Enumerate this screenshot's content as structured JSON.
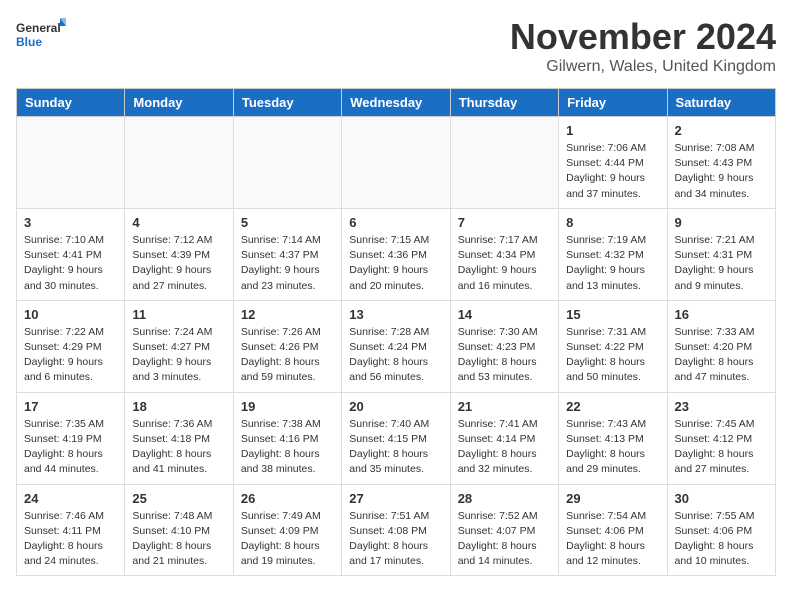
{
  "logo": {
    "general": "General",
    "blue": "Blue"
  },
  "title": "November 2024",
  "location": "Gilwern, Wales, United Kingdom",
  "headers": [
    "Sunday",
    "Monday",
    "Tuesday",
    "Wednesday",
    "Thursday",
    "Friday",
    "Saturday"
  ],
  "weeks": [
    [
      {
        "day": "",
        "info": ""
      },
      {
        "day": "",
        "info": ""
      },
      {
        "day": "",
        "info": ""
      },
      {
        "day": "",
        "info": ""
      },
      {
        "day": "",
        "info": ""
      },
      {
        "day": "1",
        "info": "Sunrise: 7:06 AM\nSunset: 4:44 PM\nDaylight: 9 hours and 37 minutes."
      },
      {
        "day": "2",
        "info": "Sunrise: 7:08 AM\nSunset: 4:43 PM\nDaylight: 9 hours and 34 minutes."
      }
    ],
    [
      {
        "day": "3",
        "info": "Sunrise: 7:10 AM\nSunset: 4:41 PM\nDaylight: 9 hours and 30 minutes."
      },
      {
        "day": "4",
        "info": "Sunrise: 7:12 AM\nSunset: 4:39 PM\nDaylight: 9 hours and 27 minutes."
      },
      {
        "day": "5",
        "info": "Sunrise: 7:14 AM\nSunset: 4:37 PM\nDaylight: 9 hours and 23 minutes."
      },
      {
        "day": "6",
        "info": "Sunrise: 7:15 AM\nSunset: 4:36 PM\nDaylight: 9 hours and 20 minutes."
      },
      {
        "day": "7",
        "info": "Sunrise: 7:17 AM\nSunset: 4:34 PM\nDaylight: 9 hours and 16 minutes."
      },
      {
        "day": "8",
        "info": "Sunrise: 7:19 AM\nSunset: 4:32 PM\nDaylight: 9 hours and 13 minutes."
      },
      {
        "day": "9",
        "info": "Sunrise: 7:21 AM\nSunset: 4:31 PM\nDaylight: 9 hours and 9 minutes."
      }
    ],
    [
      {
        "day": "10",
        "info": "Sunrise: 7:22 AM\nSunset: 4:29 PM\nDaylight: 9 hours and 6 minutes."
      },
      {
        "day": "11",
        "info": "Sunrise: 7:24 AM\nSunset: 4:27 PM\nDaylight: 9 hours and 3 minutes."
      },
      {
        "day": "12",
        "info": "Sunrise: 7:26 AM\nSunset: 4:26 PM\nDaylight: 8 hours and 59 minutes."
      },
      {
        "day": "13",
        "info": "Sunrise: 7:28 AM\nSunset: 4:24 PM\nDaylight: 8 hours and 56 minutes."
      },
      {
        "day": "14",
        "info": "Sunrise: 7:30 AM\nSunset: 4:23 PM\nDaylight: 8 hours and 53 minutes."
      },
      {
        "day": "15",
        "info": "Sunrise: 7:31 AM\nSunset: 4:22 PM\nDaylight: 8 hours and 50 minutes."
      },
      {
        "day": "16",
        "info": "Sunrise: 7:33 AM\nSunset: 4:20 PM\nDaylight: 8 hours and 47 minutes."
      }
    ],
    [
      {
        "day": "17",
        "info": "Sunrise: 7:35 AM\nSunset: 4:19 PM\nDaylight: 8 hours and 44 minutes."
      },
      {
        "day": "18",
        "info": "Sunrise: 7:36 AM\nSunset: 4:18 PM\nDaylight: 8 hours and 41 minutes."
      },
      {
        "day": "19",
        "info": "Sunrise: 7:38 AM\nSunset: 4:16 PM\nDaylight: 8 hours and 38 minutes."
      },
      {
        "day": "20",
        "info": "Sunrise: 7:40 AM\nSunset: 4:15 PM\nDaylight: 8 hours and 35 minutes."
      },
      {
        "day": "21",
        "info": "Sunrise: 7:41 AM\nSunset: 4:14 PM\nDaylight: 8 hours and 32 minutes."
      },
      {
        "day": "22",
        "info": "Sunrise: 7:43 AM\nSunset: 4:13 PM\nDaylight: 8 hours and 29 minutes."
      },
      {
        "day": "23",
        "info": "Sunrise: 7:45 AM\nSunset: 4:12 PM\nDaylight: 8 hours and 27 minutes."
      }
    ],
    [
      {
        "day": "24",
        "info": "Sunrise: 7:46 AM\nSunset: 4:11 PM\nDaylight: 8 hours and 24 minutes."
      },
      {
        "day": "25",
        "info": "Sunrise: 7:48 AM\nSunset: 4:10 PM\nDaylight: 8 hours and 21 minutes."
      },
      {
        "day": "26",
        "info": "Sunrise: 7:49 AM\nSunset: 4:09 PM\nDaylight: 8 hours and 19 minutes."
      },
      {
        "day": "27",
        "info": "Sunrise: 7:51 AM\nSunset: 4:08 PM\nDaylight: 8 hours and 17 minutes."
      },
      {
        "day": "28",
        "info": "Sunrise: 7:52 AM\nSunset: 4:07 PM\nDaylight: 8 hours and 14 minutes."
      },
      {
        "day": "29",
        "info": "Sunrise: 7:54 AM\nSunset: 4:06 PM\nDaylight: 8 hours and 12 minutes."
      },
      {
        "day": "30",
        "info": "Sunrise: 7:55 AM\nSunset: 4:06 PM\nDaylight: 8 hours and 10 minutes."
      }
    ]
  ]
}
